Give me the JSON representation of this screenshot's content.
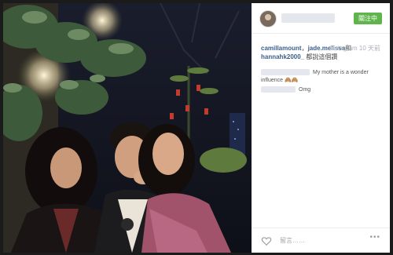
{
  "post": {
    "username": "",
    "follow_label": "關注中",
    "tag_user_1": "camillamount",
    "tag_separator": "，",
    "tag_user_2": "jade.melissa",
    "tag_and": "和",
    "tag_user_3": "hannahk2000_",
    "tag_suffix": "都說這個讚",
    "time": "Instagram 10 天前"
  },
  "comments": [
    {
      "text": "My mother is a wonder influence 🙈🙈"
    },
    {
      "text": "Omg"
    }
  ],
  "footer": {
    "comment_placeholder": "留言……",
    "more_label": "•••"
  },
  "colors": {
    "follow_button": "#5fb54c",
    "link": "#3b5f8a"
  },
  "icons": [
    "heart-icon",
    "more-options-icon"
  ]
}
